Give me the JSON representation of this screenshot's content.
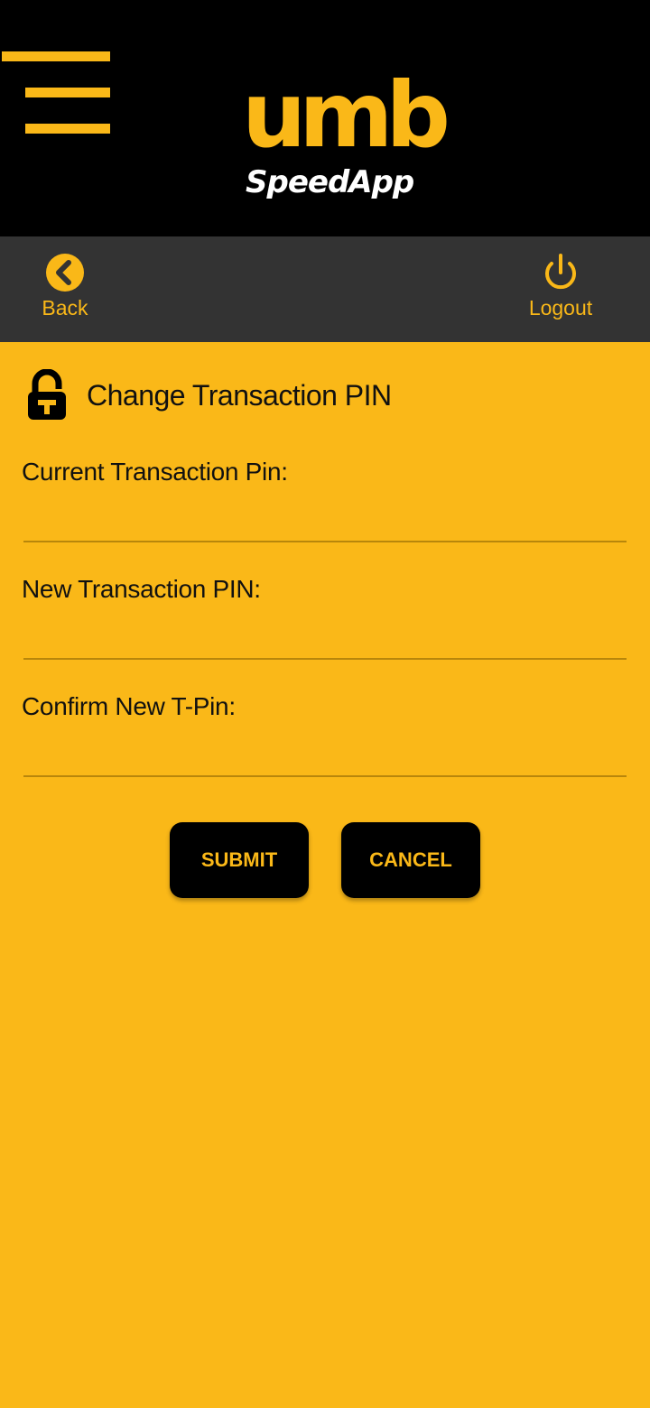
{
  "header": {
    "logo_mark": "umb",
    "logo_sub": "SpeedApp",
    "menu_icon": "hamburger-menu-icon"
  },
  "nav": {
    "back_label": "Back",
    "back_icon": "chevron-left-circle-icon",
    "logout_label": "Logout",
    "logout_icon": "power-icon"
  },
  "page": {
    "title": "Change Transaction PIN",
    "title_icon": "padlock-icon"
  },
  "form": {
    "current_pin_label": "Current Transaction Pin:",
    "current_pin_value": "",
    "new_pin_label": "New Transaction PIN:",
    "new_pin_value": "",
    "confirm_pin_label": "Confirm New T-Pin:",
    "confirm_pin_value": ""
  },
  "actions": {
    "submit_label": "SUBMIT",
    "cancel_label": "CANCEL"
  },
  "colors": {
    "brand_yellow": "#fab818",
    "header_black": "#000000",
    "navbar_gray": "#333333"
  }
}
